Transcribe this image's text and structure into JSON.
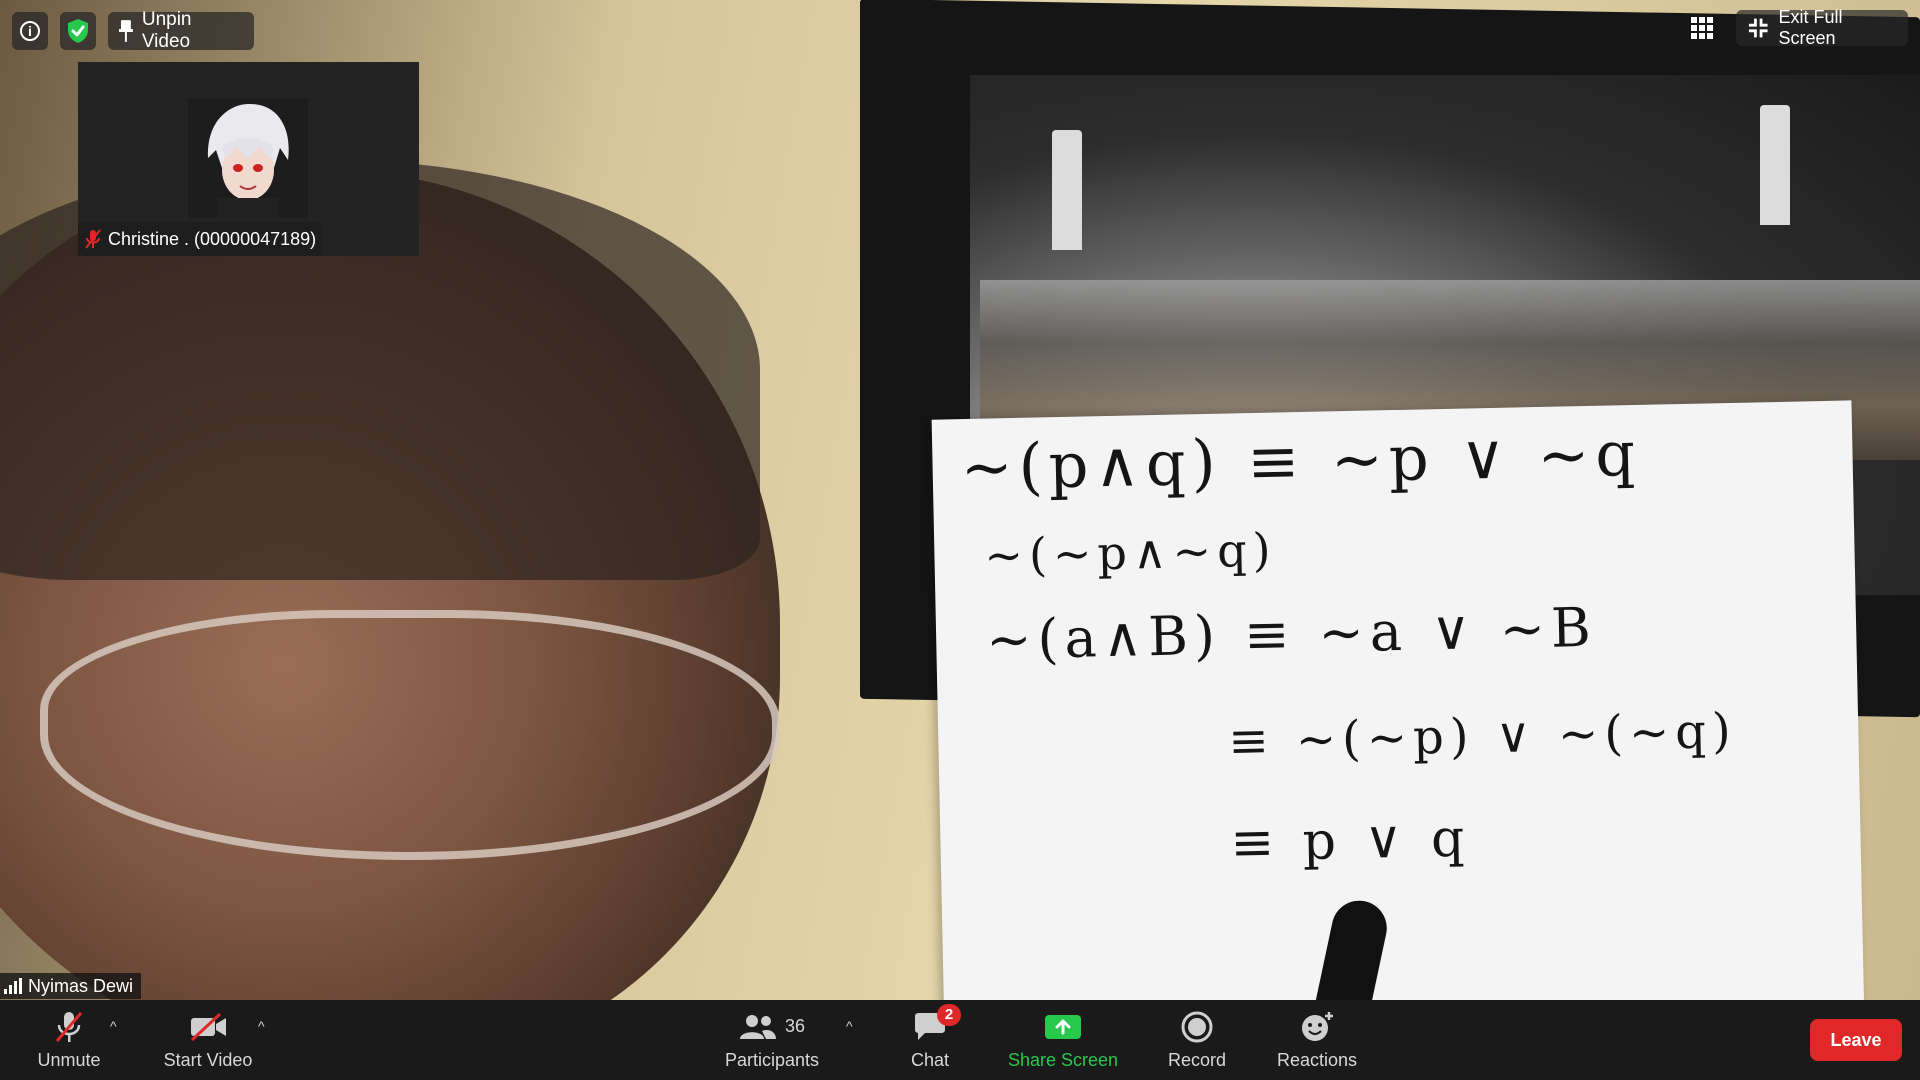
{
  "top_controls": {
    "unpin_label": "Unpin Video",
    "exit_fullscreen_label": "Exit Full Screen"
  },
  "pinned_participant": {
    "name": "Christine . (00000047189)"
  },
  "active_speaker": {
    "name": "Nyimas Dewi"
  },
  "whiteboard": {
    "lines": [
      "~(p∧q) ≡ ~p ∨ ~q",
      "~(~p∧~q)",
      "~(a∧B) ≡ ~a ∨ ~B",
      "≡ ~(~p) ∨ ~(~q)",
      "≡ p ∨ q"
    ]
  },
  "toolbar": {
    "unmute_label": "Unmute",
    "start_video_label": "Start Video",
    "participants_label": "Participants",
    "participants_count": "36",
    "chat_label": "Chat",
    "chat_badge": "2",
    "share_screen_label": "Share Screen",
    "record_label": "Record",
    "reactions_label": "Reactions",
    "leave_label": "Leave"
  },
  "colors": {
    "accent_green": "#27c84b",
    "leave_red": "#e02828",
    "toolbar_bg": "#1a1a1a"
  }
}
